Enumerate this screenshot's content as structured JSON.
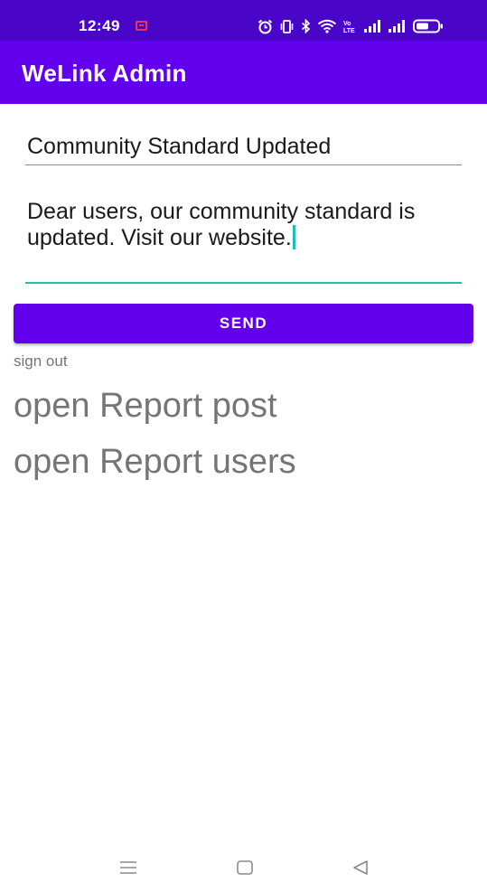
{
  "status_bar": {
    "time": "12:49",
    "icons": [
      "notification-icon",
      "alarm-icon",
      "vibrate-icon",
      "bluetooth-icon",
      "wifi-icon",
      "volte-icon",
      "signal-icon",
      "signal-icon",
      "battery-icon"
    ],
    "volte_label": "Vo LTE"
  },
  "app_bar": {
    "title": "WeLink Admin"
  },
  "form": {
    "title_value": "Community Standard Updated",
    "message_value": "Dear users, our community standard is updated. Visit our website.",
    "send_label": "SEND"
  },
  "links": {
    "sign_out": "sign out",
    "report_post": "open Report post",
    "report_users": "open Report users"
  },
  "nav_bar": {
    "icons": [
      "menu-icon",
      "home-icon",
      "back-icon"
    ]
  },
  "colors": {
    "status_bar": "#4a06c8",
    "primary": "#6200ee",
    "accent": "#1fbfb0",
    "link_gray": "#757575"
  }
}
